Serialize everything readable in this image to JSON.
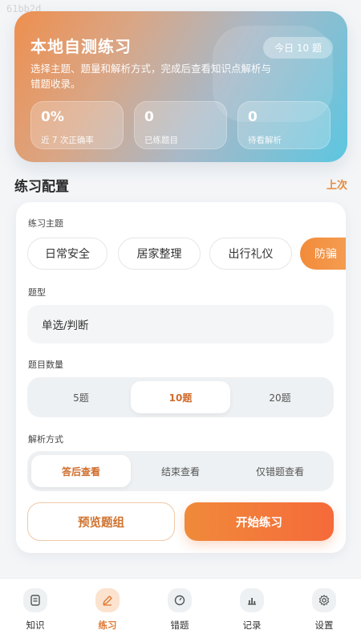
{
  "watermark": "61bb2d",
  "hero": {
    "title": "本地自测练习",
    "desc": "选择主题、题量和解析方式，完成后查看知识点解析与错题收录。",
    "today_badge": "今日 10 题",
    "stats": [
      {
        "value": "0%",
        "label": "近 7 次正确率"
      },
      {
        "value": "0",
        "label": "已练题目"
      },
      {
        "value": "0",
        "label": "待看解析"
      }
    ]
  },
  "section": {
    "title": "练习配置",
    "link": "上次"
  },
  "config": {
    "topic_label": "练习主题",
    "topics": [
      {
        "label": "日常安全",
        "active": false
      },
      {
        "label": "居家整理",
        "active": false
      },
      {
        "label": "出行礼仪",
        "active": false
      },
      {
        "label": "防骗",
        "active": true
      }
    ],
    "type_label": "题型",
    "type_value": "单选/判断",
    "count_label": "题目数量",
    "counts": [
      "5题",
      "10题",
      "20题"
    ],
    "count_selected": "10题",
    "analysis_label": "解析方式",
    "analysis_modes": [
      "答后查看",
      "结束查看",
      "仅错题查看"
    ],
    "analysis_selected": "答后查看",
    "preview_button": "预览题组",
    "start_button": "开始练习"
  },
  "nav": {
    "items": [
      {
        "label": "知识",
        "icon": "document-icon"
      },
      {
        "label": "练习",
        "icon": "pen-icon"
      },
      {
        "label": "错题",
        "icon": "gauge-icon"
      },
      {
        "label": "记录",
        "icon": "bar-chart-icon"
      },
      {
        "label": "设置",
        "icon": "gear-icon"
      }
    ],
    "active": "练习"
  },
  "colors": {
    "accent": "#f08a3a",
    "accent_text": "#d0722e",
    "hero_start": "#ee8f4f",
    "hero_end": "#5cc6e0"
  }
}
